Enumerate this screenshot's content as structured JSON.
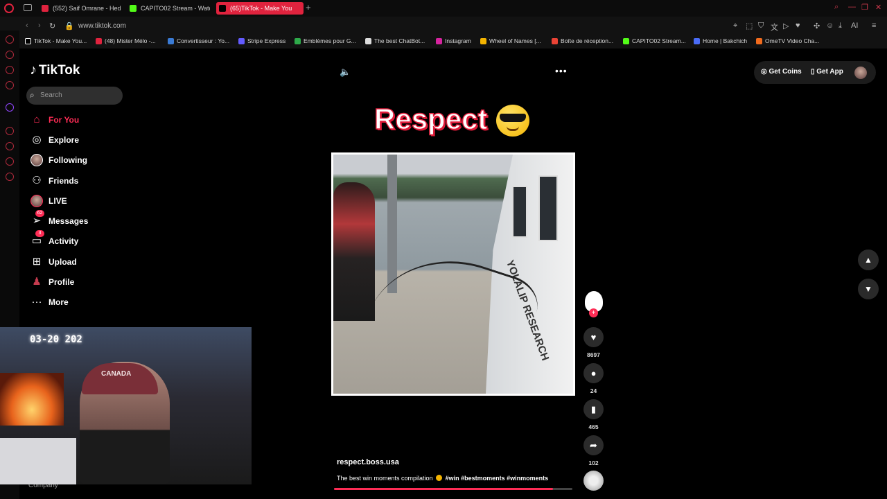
{
  "browser": {
    "tabs": [
      {
        "label": "(552) Saif Omrane - Hedh",
        "color": "#e0233e"
      },
      {
        "label": "CAPITO02 Stream - Watc",
        "color": "#53fc18"
      },
      {
        "label": "(65)TikTok - Make You",
        "color": "#000000"
      }
    ],
    "url": "www.tiktok.com",
    "bookmarks": [
      {
        "label": "TikTok - Make You...",
        "color": "#000000"
      },
      {
        "label": "(48) Mister Mélo -...",
        "color": "#e0233e"
      },
      {
        "label": "Convertisseur : Yo...",
        "color": "#3a7bd5"
      },
      {
        "label": "Stripe Express",
        "color": "#635bff"
      },
      {
        "label": "Emblèmes pour G...",
        "color": "#2eaa4a"
      },
      {
        "label": "The best ChatBot...",
        "color": "#dddddd"
      },
      {
        "label": "Instagram",
        "color": "#d6249f"
      },
      {
        "label": "Wheel of Names [...",
        "color": "#f4b400"
      },
      {
        "label": "Boîte de réception...",
        "color": "#ea4335"
      },
      {
        "label": "CAPITO02 Stream...",
        "color": "#53fc18"
      },
      {
        "label": "Home | Bakchich",
        "color": "#4a6cf7"
      },
      {
        "label": "OmeTV Video Cha...",
        "color": "#f26b1d"
      }
    ]
  },
  "tiktok": {
    "logo": "TikTok",
    "search_placeholder": "Search",
    "nav": [
      {
        "label": "For You",
        "icon": "home-icon"
      },
      {
        "label": "Explore",
        "icon": "compass-icon"
      },
      {
        "label": "Following",
        "icon": "avatar"
      },
      {
        "label": "Friends",
        "icon": "friends-icon"
      },
      {
        "label": "LIVE",
        "icon": "live-avatar"
      },
      {
        "label": "Messages",
        "icon": "send-icon",
        "badge": "62"
      },
      {
        "label": "Activity",
        "icon": "chat-icon",
        "badge": "3"
      },
      {
        "label": "Upload",
        "icon": "plus-square-icon"
      },
      {
        "label": "Profile",
        "icon": "profile-avatar"
      },
      {
        "label": "More",
        "icon": "more-icon"
      }
    ],
    "footer": "Company",
    "header": {
      "get_coins": "Get Coins",
      "get_app": "Get App"
    },
    "video": {
      "overlay_title": "Respect",
      "boat_text": "YOLALIP RESEARCH",
      "author": "respect.boss.usa",
      "caption_before": "The best win moments compilation",
      "caption_tags": "#win #bestmoments #winmoments",
      "progress": 0.92
    },
    "actions": {
      "likes": "8697",
      "comments": "24",
      "saves": "465",
      "shares": "102"
    }
  },
  "webcam": {
    "clock": "03-20 202",
    "cap_text": "CANADA"
  }
}
